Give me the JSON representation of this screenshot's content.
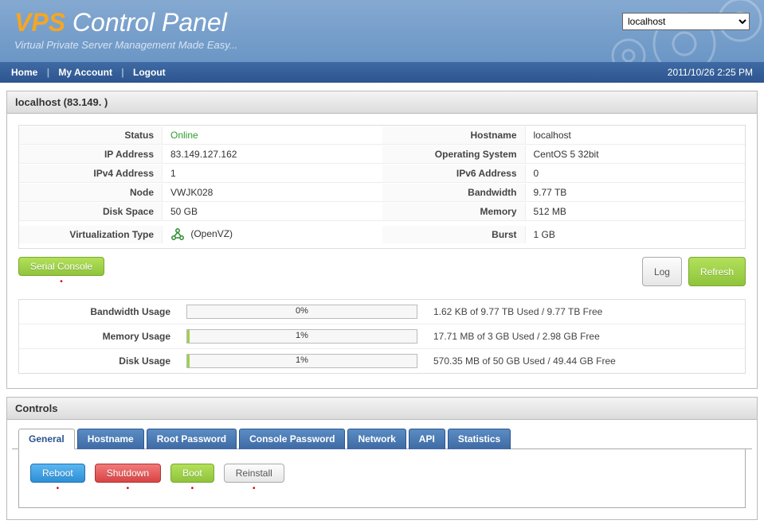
{
  "header": {
    "title_vps": "VPS",
    "title_rest": " Control Panel",
    "tagline": "Virtual Private Server Management Made Easy...",
    "server_select_value": "localhost"
  },
  "nav": {
    "home": "Home",
    "my_account": "My Account",
    "logout": "Logout",
    "datetime": "2011/10/26 2:25 PM"
  },
  "server": {
    "heading": "localhost (83.149.            )",
    "info_left": {
      "status_label": "Status",
      "status_value": "Online",
      "ip_label": "IP Address",
      "ip_value": "83.149.127.162",
      "ipv4_label": "IPv4 Address",
      "ipv4_value": "1",
      "node_label": "Node",
      "node_value": "VWJK028",
      "disk_label": "Disk Space",
      "disk_value": "50 GB",
      "virt_label": "Virtualization Type",
      "virt_value": "(OpenVZ)"
    },
    "info_right": {
      "hostname_label": "Hostname",
      "hostname_value": "localhost",
      "os_label": "Operating System",
      "os_value": "CentOS 5 32bit",
      "ipv6_label": "IPv6 Address",
      "ipv6_value": "0",
      "bw_label": "Bandwidth",
      "bw_value": "9.77 TB",
      "mem_label": "Memory",
      "mem_value": "512 MB",
      "burst_label": "Burst",
      "burst_value": "1 GB"
    },
    "buttons": {
      "serial": "Serial Console",
      "log": "Log",
      "refresh": "Refresh"
    },
    "usage": {
      "bw_label": "Bandwidth Usage",
      "bw_pct": "0%",
      "bw_text": "1.62 KB of 9.77 TB Used / 9.77 TB Free",
      "bw_fill": "0%",
      "mem_label": "Memory Usage",
      "mem_pct": "1%",
      "mem_text": "17.71 MB of 3 GB Used / 2.98 GB Free",
      "mem_fill": "1%",
      "disk_label": "Disk Usage",
      "disk_pct": "1%",
      "disk_text": "570.35 MB of 50 GB Used / 49.44 GB Free",
      "disk_fill": "1%"
    }
  },
  "controls": {
    "heading": "Controls",
    "tabs": {
      "general": "General",
      "hostname": "Hostname",
      "root_password": "Root Password",
      "console_password": "Console Password",
      "network": "Network",
      "api": "API",
      "statistics": "Statistics"
    },
    "actions": {
      "reboot": "Reboot",
      "shutdown": "Shutdown",
      "boot": "Boot",
      "reinstall": "Reinstall"
    }
  }
}
